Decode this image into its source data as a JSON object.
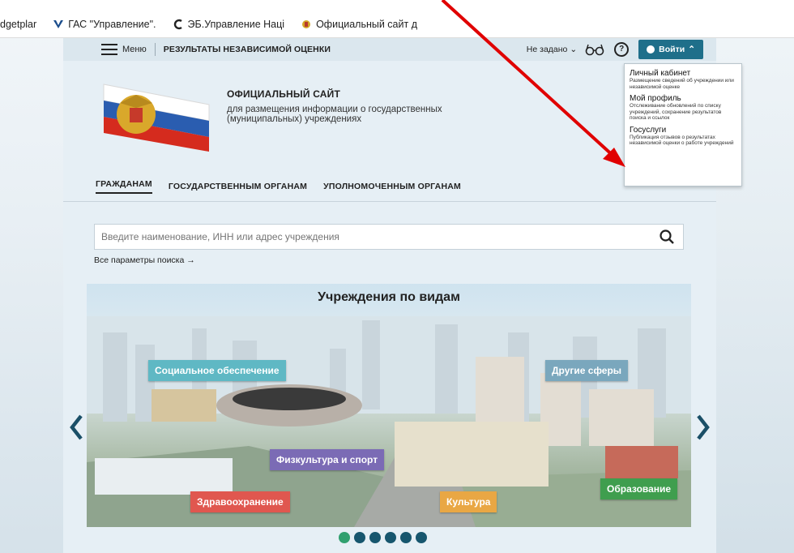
{
  "bookmarks": [
    {
      "label": "dgetplar",
      "icon": "page-icon"
    },
    {
      "label": "ГАС \"Управление\".",
      "icon": "v-logo-icon"
    },
    {
      "label": "ЭБ.Управление Наці",
      "icon": "c-logo-icon"
    },
    {
      "label": "Официальный сайт д",
      "icon": "emblem-icon"
    }
  ],
  "navbar": {
    "menu_label": "Меню",
    "title": "РЕЗУЛЬТАТЫ НЕЗАВИСИМОЙ ОЦЕНКИ",
    "region": "Не задано",
    "help": "?",
    "login_label": "Войти"
  },
  "header": {
    "site_title": "ОФИЦИАЛЬНЫЙ САЙТ",
    "site_subtitle": "для размещения информации о государственных (муниципальных) учреждениях"
  },
  "tabs": [
    "ГРАЖДАНАМ",
    "ГОСУДАРСТВЕННЫМ ОРГАНАМ",
    "УПОЛНОМОЧЕННЫМ ОРГАНАМ"
  ],
  "search": {
    "placeholder": "Введите наименование, ИНН или адрес учреждения",
    "all_params": "Все параметры поиска →"
  },
  "hero": {
    "title": "Учреждения по видам",
    "tags": [
      {
        "label": "Социальное обеспечение",
        "color": "#5fb8c4"
      },
      {
        "label": "Другие сферы",
        "color": "#7aa7bd"
      },
      {
        "label": "Физкультура и спорт",
        "color": "#7b6bb5"
      },
      {
        "label": "Здравоохранение",
        "color": "#e0574f"
      },
      {
        "label": "Культура",
        "color": "#e9a744"
      },
      {
        "label": "Образование",
        "color": "#3f9e4e"
      }
    ],
    "dots_count": 6,
    "active_dot": 1
  },
  "dropdown": {
    "items": [
      {
        "title": "Личный кабинет",
        "desc": "Размещение сведений об учреждении или независимой оценке"
      },
      {
        "title": "Мой профиль",
        "desc": "Отслеживание обновлений по списку учреждений, сохранение результатов поиска и ссылок"
      },
      {
        "title": "Госуслуги",
        "desc": "Публикация отзывов о результатах независимой оценки о работе учреждений"
      }
    ]
  },
  "colors": {
    "accent": "#1f6f8a",
    "annotation_arrow": "#e00000",
    "dot": "#17566e",
    "dot_active": "#30a06f"
  }
}
